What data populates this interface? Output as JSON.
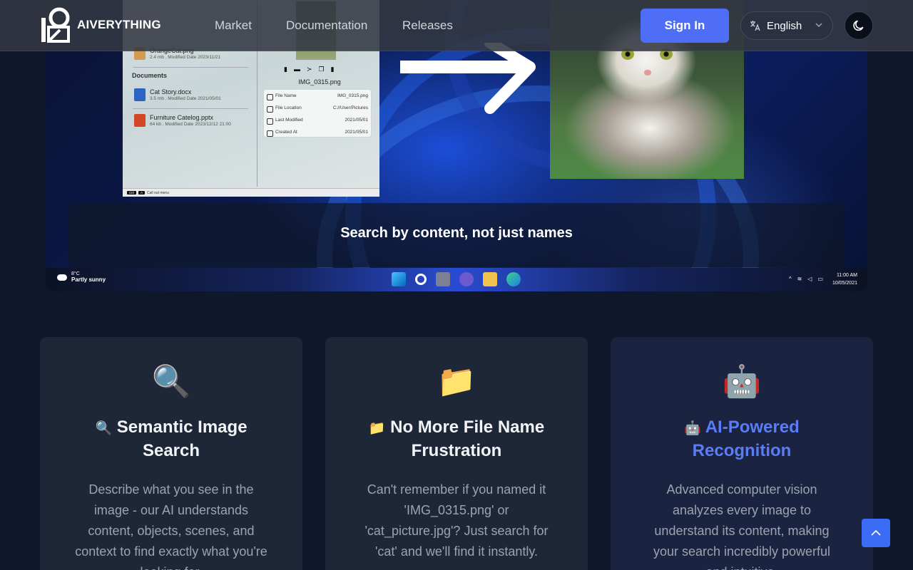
{
  "nav": {
    "logo_text": "AIVERYTHING",
    "links": [
      "Market",
      "Documentation",
      "Releases"
    ],
    "sign_in": "Sign In",
    "language": "English"
  },
  "hero": {
    "caption": "Search by content, not just names",
    "explorer": {
      "files_top": {
        "name": "OrangeCat.png",
        "meta": "2.4 mb . Modified Date 2023/11/21"
      },
      "section_title": "Documents",
      "documents": [
        {
          "name": "Cat Story.docx",
          "meta": "3.5 mb . Modified Date 2021/05/01"
        },
        {
          "name": "Furniture Catelog.pptx",
          "meta": "64 kb . Modified Date 2023/12/12 21:00"
        }
      ],
      "image_title": "IMG_0315.png",
      "properties": [
        {
          "key": "File Name",
          "value": "IMG_0315.png"
        },
        {
          "key": "File Location",
          "value": "C://User/Pictures"
        },
        {
          "key": "Last Modified",
          "value": "2021/05/01"
        },
        {
          "key": "Created At",
          "value": "2021/05/01"
        }
      ],
      "status_key1": "Ctrl",
      "status_key2": "A",
      "status_text": "Call out menu"
    },
    "taskbar": {
      "temp": "8°C",
      "weather": "Partly sunny",
      "time": "11:00 AM",
      "date": "10/05/2021"
    }
  },
  "features": [
    {
      "emoji": "🔍",
      "title_emoji": "🔍",
      "title": "Semantic Image Search",
      "desc": "Describe what you see in the image - our AI understands content, objects, scenes, and context to find exactly what you're looking for."
    },
    {
      "emoji": "📁",
      "title_emoji": "📁",
      "title": "No More File Name Frustration",
      "desc": "Can't remember if you named it 'IMG_0315.png' or 'cat_picture.jpg'? Just search for 'cat' and we'll find it instantly."
    },
    {
      "emoji": "🤖",
      "title_emoji": "🤖",
      "title": "AI-Powered Recognition",
      "desc": "Advanced computer vision analyzes every image to understand its content, making your search incredibly powerful and intuitive."
    }
  ],
  "colors": {
    "accent": "#4f6ef7",
    "highlight_title": "#5b7cf7",
    "page_bg": "#0f172a",
    "card_bg": "#1e2738"
  }
}
